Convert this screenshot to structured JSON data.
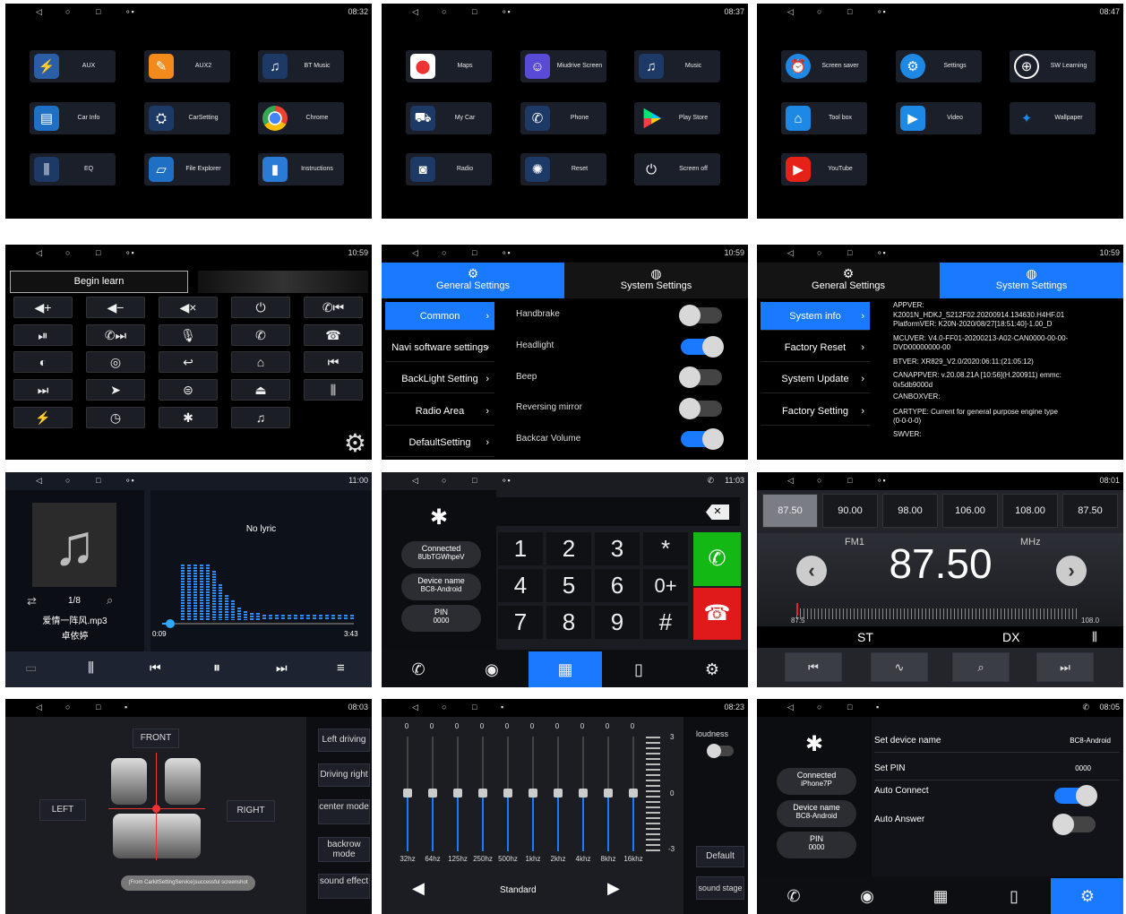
{
  "status": {
    "p1": "08:32",
    "p2": "08:37",
    "p3": "08:47",
    "p4": "10:59",
    "p5": "10:59",
    "p6": "10:59",
    "p7": "11:00",
    "p8": "11:03",
    "p9": "08:01",
    "p10": "08:03",
    "p11": "08:23",
    "p12": "08:05"
  },
  "launcher1": [
    "AUX",
    "AUX2",
    "BT Music",
    "Car Info",
    "CarSetting",
    "Chrome",
    "EQ",
    "File Explorer",
    "Instructions"
  ],
  "launcher2": [
    "Maps",
    "Miudrive Screen",
    "Music",
    "My Car",
    "Phone",
    "Play Store",
    "Radio",
    "Reset",
    "Screen off"
  ],
  "launcher3": [
    "Screen saver",
    "Settings",
    "SW Learning",
    "Tool box",
    "Video",
    "Wallpaper",
    "YouTube"
  ],
  "learn": {
    "begin": "Begin learn"
  },
  "settings": {
    "general_tab": "General Settings",
    "system_tab": "System Settings",
    "menu": [
      "Common",
      "Navi software settings",
      "BackLight Setting",
      "Radio Area",
      "DefaultSetting"
    ],
    "rows": [
      "Handbrake",
      "Headlight",
      "Beep",
      "Reversing mirror",
      "Backcar Volume"
    ],
    "toggles": [
      false,
      true,
      false,
      false,
      true
    ],
    "sys_menu": [
      "System info",
      "Factory Reset",
      "System Update",
      "Factory Setting"
    ],
    "info": [
      "APPVER:",
      "K2001N_HDKJ_S212F02.20200914.134630.H4HF.01",
      "PlatformVER: K20N-2020/08/27[18:51:40]-1.00_D",
      "MCUVER: V4.0-FF01-20200213-A02-CAN0000-00-00-",
      "DVD00000000-00",
      "BTVER: XR829_V2.0/2020:06:11:(21:05:12)",
      "CANAPPVER: v.20.08.21A [10:56](H.200911)  emmc:",
      "0x5db9000d",
      "CANBOXVER:",
      "CARTYPE: Current for general purpose engine type",
      "(0-0-0-0)",
      "SWVER:"
    ]
  },
  "music": {
    "lyric": "No lyric",
    "counter": "1/8",
    "file": "爱情一阵风.mp3",
    "artist": "卓依婷",
    "elapsed": "0:09",
    "total": "3:43",
    "progress": 0.04
  },
  "phone": {
    "connected": "Connected",
    "conn_id": "8UbTGWhpeV",
    "device_label": "Device name",
    "device": "BC8-Android",
    "pin_label": "PIN",
    "pin": "0000",
    "keys": [
      "1",
      "2",
      "3",
      "*",
      "4",
      "5",
      "6",
      "0+",
      "7",
      "8",
      "9",
      "#"
    ]
  },
  "radio": {
    "presets": [
      "87.50",
      "90.00",
      "98.00",
      "106.00",
      "108.00",
      "87.50"
    ],
    "band": "FM1",
    "unit": "MHz",
    "freq": "87.50",
    "min": "87.5",
    "max": "108.0",
    "st": "ST",
    "dx": "DX"
  },
  "balance": {
    "front": "FRONT",
    "left": "LEFT",
    "right": "RIGHT",
    "side": [
      "Left driving",
      "Driving right",
      "center mode",
      "backrow mode",
      "sound effect"
    ],
    "toast": "(From CarkitSettingService)successful screenshot"
  },
  "eq": {
    "values": [
      "0",
      "0",
      "0",
      "0",
      "0",
      "0",
      "0",
      "0",
      "0",
      "0"
    ],
    "freqs": [
      "32hz",
      "64hz",
      "125hz",
      "250hz",
      "500hz",
      "1khz",
      "2khz",
      "4khz",
      "8khz",
      "16khz"
    ],
    "scale": [
      "3",
      "0",
      "-3"
    ],
    "loudness": "loudness",
    "default": "Default",
    "preset": "Standard",
    "stage": "sound stage"
  },
  "bt": {
    "connected": "Connected",
    "phone": "iPhone7P",
    "device_label": "Device name",
    "device": "BC8-Android",
    "pin_label": "PIN",
    "pin": "0000",
    "rows": [
      "Set device name",
      "Set PIN",
      "Auto Connect",
      "Auto Answer"
    ],
    "row_vals": [
      "BC8-Android",
      "0000"
    ],
    "toggles": [
      true,
      false
    ]
  },
  "colors": {
    "accent": "#1979ff",
    "call": "#14b814",
    "hangup": "#e01a1a"
  }
}
